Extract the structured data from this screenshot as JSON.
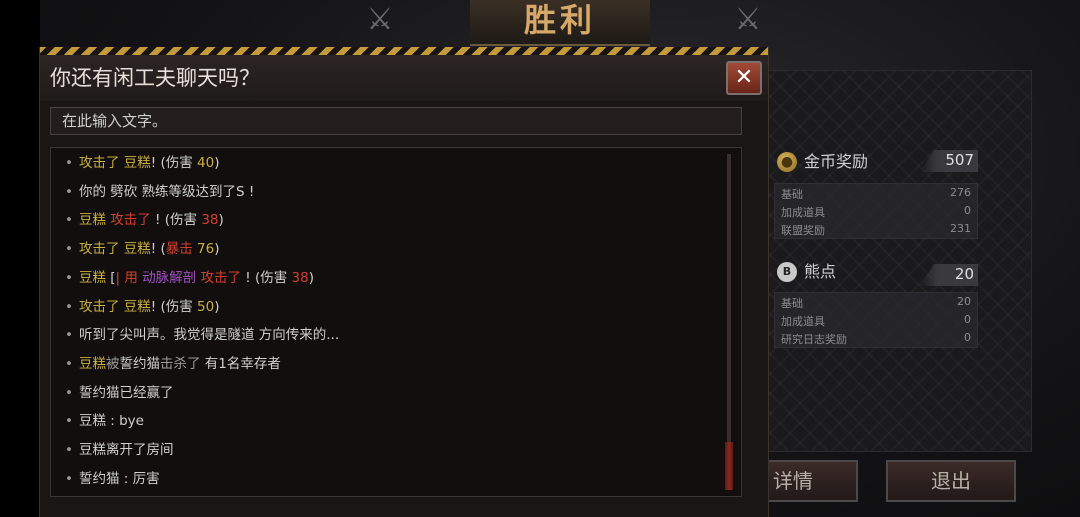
{
  "victory_title": "胜利",
  "dialog": {
    "title": "你还有闲工夫聊天吗？",
    "close_symbol": "✕",
    "input_placeholder": "在此输入文字。"
  },
  "chat_lines": [
    [
      {
        "t": "攻击了 豆糕",
        "c": "yellow"
      },
      {
        "t": "! (伤害 ",
        "c": "white"
      },
      {
        "t": "40",
        "c": "yellow"
      },
      {
        "t": ")",
        "c": "white"
      }
    ],
    [
      {
        "t": "你的 劈砍 熟练等级达到了S !",
        "c": "white"
      }
    ],
    [
      {
        "t": "豆糕 ",
        "c": "yellow"
      },
      {
        "t": " 攻击了",
        "c": "red"
      },
      {
        "t": " ! (伤害 ",
        "c": "white"
      },
      {
        "t": "38",
        "c": "red"
      },
      {
        "t": ")",
        "c": "white"
      }
    ],
    [
      {
        "t": "攻击了 豆糕",
        "c": "yellow"
      },
      {
        "t": "! (",
        "c": "white"
      },
      {
        "t": "暴击 ",
        "c": "red"
      },
      {
        "t": "76",
        "c": "yellow"
      },
      {
        "t": ")",
        "c": "white"
      }
    ],
    [
      {
        "t": "豆糕 ",
        "c": "yellow"
      },
      {
        "t": "[",
        "c": "white"
      },
      {
        "t": "| 用 ",
        "c": "red"
      },
      {
        "t": "动脉解剖 ",
        "c": "purple"
      },
      {
        "t": "攻击了 ",
        "c": "red"
      },
      {
        "t": " ! (伤害 ",
        "c": "white"
      },
      {
        "t": "38",
        "c": "red"
      },
      {
        "t": ")",
        "c": "white"
      }
    ],
    [
      {
        "t": "攻击了 豆糕",
        "c": "yellow"
      },
      {
        "t": "! (伤害 ",
        "c": "white"
      },
      {
        "t": "50",
        "c": "yellow"
      },
      {
        "t": ")",
        "c": "white"
      }
    ],
    [
      {
        "t": "听到了尖叫声。我觉得是隧道 方向传来的...",
        "c": "white"
      }
    ],
    [
      {
        "t": "豆糕",
        "c": "yellow"
      },
      {
        "t": "被",
        "c": "gray"
      },
      {
        "t": "誓约猫",
        "c": "white"
      },
      {
        "t": "击杀了 ",
        "c": "gray"
      },
      {
        "t": "有1名幸存者",
        "c": "white"
      }
    ],
    [
      {
        "t": "誓约猫已经赢了",
        "c": "white"
      }
    ],
    [
      {
        "t": "豆糕 : bye",
        "c": "white"
      }
    ],
    [
      {
        "t": "豆糕离开了房间",
        "c": "white"
      }
    ],
    [
      {
        "t": "誓约猫 : 厉害",
        "c": "white"
      }
    ]
  ],
  "rewards": {
    "gold": {
      "icon": "coin-icon",
      "title": "金币奖励",
      "total": "507",
      "rows": [
        {
          "label": "基础",
          "value": "276"
        },
        {
          "label": "加成道具",
          "value": "0"
        },
        {
          "label": "联盟奖励",
          "value": "231"
        }
      ]
    },
    "bear": {
      "icon": "bear-point-icon",
      "icon_text": "B",
      "title": "熊点",
      "total": "20",
      "rows": [
        {
          "label": "基础",
          "value": "20"
        },
        {
          "label": "加成道具",
          "value": "0"
        },
        {
          "label": "研究日志奖励",
          "value": "0"
        }
      ]
    }
  },
  "buttons": {
    "details": "详情",
    "exit": "退出"
  }
}
